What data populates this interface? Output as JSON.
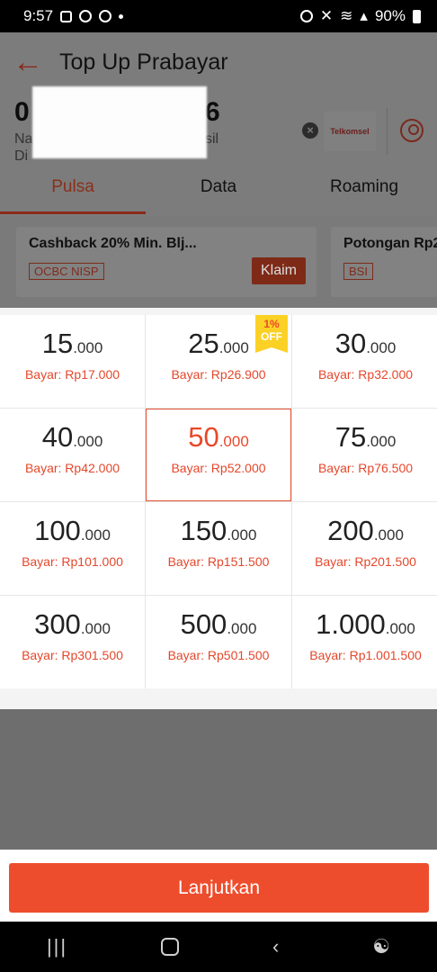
{
  "status_bar": {
    "time": "9:57",
    "battery": "90%"
  },
  "header": {
    "title": "Top Up Prabayar"
  },
  "account": {
    "phone_start": "0",
    "phone_end": "6",
    "name_line1_start": "Na",
    "name_line1_end": "sil",
    "name_line2_start": "Di",
    "operator_logo_text": "Telkomsel"
  },
  "tabs": [
    {
      "label": "Pulsa",
      "active": true
    },
    {
      "label": "Data",
      "active": false
    },
    {
      "label": "Roaming",
      "active": false
    }
  ],
  "promos": [
    {
      "title": "Cashback 20% Min. Blj...",
      "bank": "OCBC NISP",
      "claim_label": "Klaim"
    },
    {
      "title": "Potongan Rp2",
      "bank": "BSI"
    }
  ],
  "denominations": [
    {
      "main": "15",
      "suffix": ".000",
      "price": "Bayar: Rp17.000"
    },
    {
      "main": "25",
      "suffix": ".000",
      "price": "Bayar: Rp26.900",
      "badge_line1": "1%",
      "badge_line2": "OFF"
    },
    {
      "main": "30",
      "suffix": ".000",
      "price": "Bayar: Rp32.000"
    },
    {
      "main": "40",
      "suffix": ".000",
      "price": "Bayar: Rp42.000"
    },
    {
      "main": "50",
      "suffix": ".000",
      "price": "Bayar: Rp52.000",
      "selected": true
    },
    {
      "main": "75",
      "suffix": ".000",
      "price": "Bayar: Rp76.500"
    },
    {
      "main": "100",
      "suffix": ".000",
      "price": "Bayar: Rp101.000"
    },
    {
      "main": "150",
      "suffix": ".000",
      "price": "Bayar: Rp151.500"
    },
    {
      "main": "200",
      "suffix": ".000",
      "price": "Bayar: Rp201.500"
    },
    {
      "main": "300",
      "suffix": ".000",
      "price": "Bayar: Rp301.500"
    },
    {
      "main": "500",
      "suffix": ".000",
      "price": "Bayar: Rp501.500"
    },
    {
      "main": "1.000",
      "suffix": ".000",
      "price": "Bayar: Rp1.001.500"
    }
  ],
  "cta": {
    "label": "Lanjutkan"
  },
  "colors": {
    "accent": "#ee4d2d",
    "badge": "#fbd126"
  }
}
